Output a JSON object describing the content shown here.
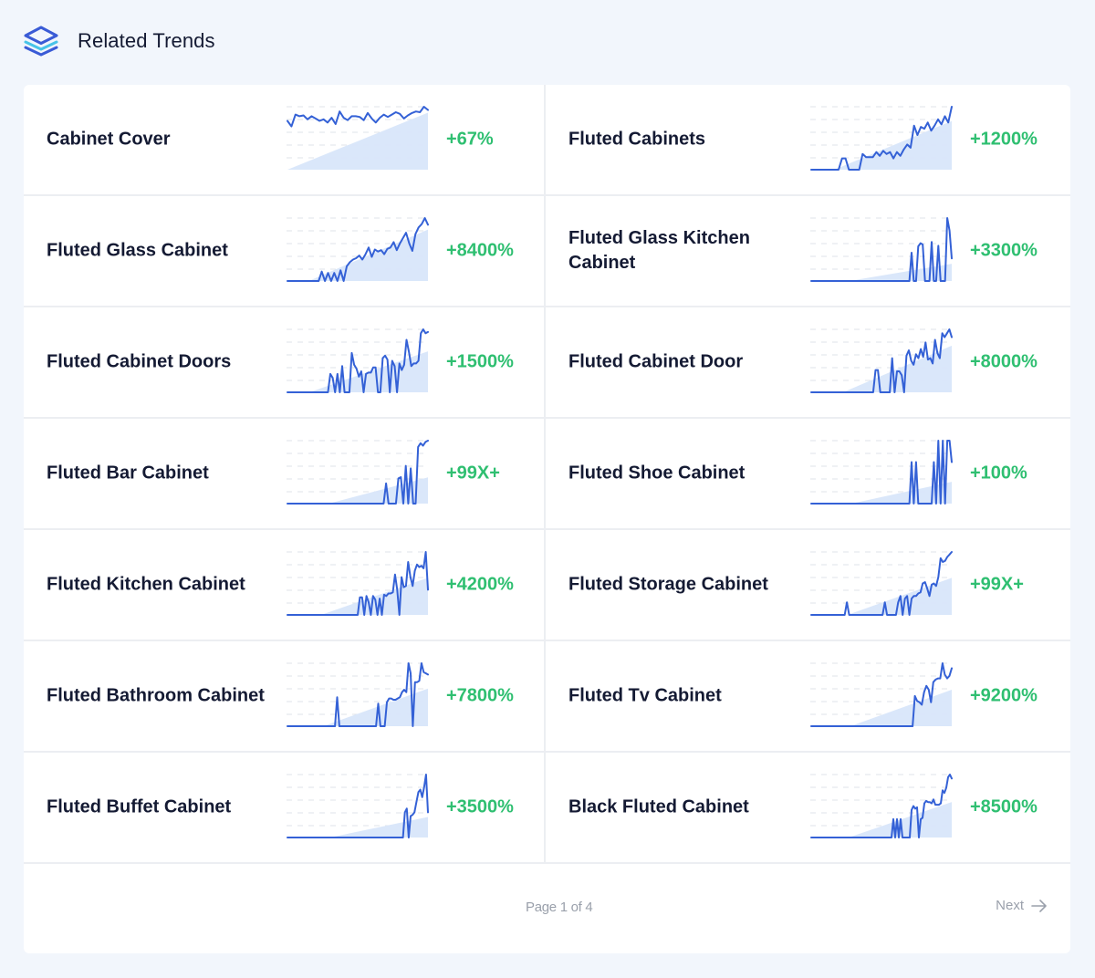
{
  "header": {
    "title": "Related Trends",
    "icon": "layers-icon"
  },
  "colors": {
    "line": "#3461d6",
    "fill": "#d8e6fa",
    "positive": "#2fbf71",
    "grid": "#dfe3ea"
  },
  "trends": [
    {
      "name": "Cabinet Cover",
      "change": "+67%",
      "series": [
        62,
        55,
        70,
        68,
        69,
        64,
        68,
        65,
        62,
        64,
        60,
        66,
        58,
        74,
        66,
        63,
        68,
        68,
        67,
        63,
        72,
        65,
        60,
        66,
        70,
        67,
        70,
        73,
        71,
        65,
        69,
        72,
        74,
        73,
        80,
        76
      ]
    },
    {
      "name": "Fluted Cabinets",
      "change": "+1200%",
      "series": [
        0,
        0,
        0,
        0,
        0,
        0,
        0,
        0,
        0,
        18,
        18,
        0,
        0,
        0,
        0,
        25,
        20,
        20,
        20,
        28,
        22,
        30,
        25,
        28,
        18,
        28,
        22,
        32,
        40,
        35,
        70,
        55,
        68,
        65,
        75,
        62,
        70,
        80,
        72,
        85,
        75,
        100
      ]
    },
    {
      "name": "Fluted Glass Cabinet",
      "change": "+8400%",
      "series": [
        0,
        0,
        0,
        0,
        0,
        0,
        0,
        0,
        0,
        0,
        0,
        14,
        0,
        12,
        0,
        12,
        0,
        16,
        0,
        22,
        28,
        32,
        34,
        38,
        32,
        40,
        50,
        36,
        47,
        44,
        46,
        40,
        48,
        50,
        58,
        46,
        56,
        64,
        72,
        56,
        45,
        70,
        80,
        85,
        94,
        84
      ]
    },
    {
      "name": "Fluted Glass Kitchen Cabinet",
      "change": "+3300%",
      "series": [
        0,
        0,
        0,
        0,
        0,
        0,
        0,
        0,
        0,
        0,
        0,
        0,
        0,
        0,
        0,
        0,
        0,
        0,
        0,
        0,
        0,
        0,
        0,
        0,
        0,
        0,
        0,
        0,
        0,
        0,
        0,
        0,
        0,
        0,
        0,
        0,
        0,
        0,
        0,
        0,
        0,
        0,
        0,
        0,
        0,
        45,
        0,
        0,
        55,
        60,
        58,
        0,
        0,
        0,
        62,
        0,
        0,
        56,
        0,
        0,
        0,
        100,
        80,
        36
      ]
    },
    {
      "name": "Fluted Cabinet Doors",
      "change": "+1500%",
      "series": [
        0,
        0,
        0,
        0,
        0,
        0,
        0,
        0,
        0,
        0,
        0,
        0,
        0,
        0,
        0,
        0,
        0,
        0,
        28,
        22,
        0,
        28,
        0,
        40,
        0,
        0,
        0,
        60,
        42,
        36,
        24,
        32,
        0,
        28,
        30,
        30,
        38,
        38,
        0,
        0,
        52,
        56,
        50,
        0,
        48,
        40,
        0,
        44,
        34,
        42,
        80,
        62,
        40,
        44,
        44,
        48,
        90,
        96,
        90,
        92
      ]
    },
    {
      "name": "Fluted Cabinet Door",
      "change": "+8000%",
      "series": [
        0,
        0,
        0,
        0,
        0,
        0,
        0,
        0,
        0,
        0,
        0,
        0,
        0,
        0,
        0,
        0,
        0,
        0,
        0,
        0,
        0,
        0,
        0,
        0,
        0,
        0,
        0,
        34,
        34,
        0,
        0,
        0,
        0,
        0,
        52,
        0,
        32,
        32,
        26,
        0,
        56,
        64,
        48,
        42,
        58,
        52,
        66,
        54,
        76,
        50,
        52,
        44,
        80,
        60,
        52,
        90,
        84,
        90,
        96,
        84
      ]
    },
    {
      "name": "Fluted Bar Cabinet",
      "change": "+99X+",
      "series": [
        0,
        0,
        0,
        0,
        0,
        0,
        0,
        0,
        0,
        0,
        0,
        0,
        0,
        0,
        0,
        0,
        0,
        0,
        0,
        0,
        0,
        0,
        0,
        0,
        0,
        0,
        0,
        0,
        0,
        0,
        0,
        0,
        0,
        0,
        0,
        0,
        0,
        0,
        0,
        0,
        32,
        0,
        0,
        0,
        0,
        40,
        42,
        0,
        60,
        0,
        56,
        0,
        0,
        90,
        96,
        92,
        98,
        100
      ]
    },
    {
      "name": "Fluted Shoe Cabinet",
      "change": "+100%",
      "series": [
        0,
        0,
        0,
        0,
        0,
        0,
        0,
        0,
        0,
        0,
        0,
        0,
        0,
        0,
        0,
        0,
        0,
        0,
        0,
        0,
        0,
        0,
        0,
        0,
        0,
        0,
        0,
        0,
        0,
        0,
        0,
        0,
        0,
        0,
        0,
        0,
        0,
        0,
        0,
        0,
        0,
        0,
        0,
        0,
        0,
        66,
        0,
        66,
        0,
        0,
        0,
        0,
        0,
        0,
        0,
        66,
        0,
        100,
        0,
        100,
        0,
        100,
        100,
        66
      ]
    },
    {
      "name": "Fluted Kitchen Cabinet",
      "change": "+4200%",
      "series": [
        0,
        0,
        0,
        0,
        0,
        0,
        0,
        0,
        0,
        0,
        0,
        0,
        0,
        0,
        0,
        0,
        0,
        0,
        0,
        0,
        0,
        0,
        0,
        0,
        0,
        0,
        0,
        0,
        0,
        0,
        0,
        0,
        0,
        28,
        28,
        0,
        30,
        20,
        0,
        30,
        24,
        0,
        26,
        0,
        32,
        30,
        34,
        34,
        36,
        64,
        40,
        0,
        60,
        44,
        46,
        84,
        60,
        46,
        70,
        80,
        76,
        78,
        74,
        100,
        40
      ]
    },
    {
      "name": "Fluted Storage Cabinet",
      "change": "+99X+",
      "series": [
        0,
        0,
        0,
        0,
        0,
        0,
        0,
        0,
        0,
        0,
        0,
        0,
        0,
        0,
        0,
        0,
        20,
        0,
        0,
        0,
        0,
        0,
        0,
        0,
        0,
        0,
        0,
        0,
        0,
        0,
        0,
        0,
        0,
        20,
        0,
        0,
        0,
        0,
        0,
        20,
        30,
        0,
        26,
        30,
        0,
        26,
        30,
        30,
        34,
        36,
        50,
        52,
        42,
        30,
        48,
        50,
        46,
        60,
        90,
        84,
        86,
        92,
        96,
        100
      ]
    },
    {
      "name": "Fluted Bathroom Cabinet",
      "change": "+7800%",
      "series": [
        0,
        0,
        0,
        0,
        0,
        0,
        0,
        0,
        0,
        0,
        0,
        0,
        0,
        0,
        0,
        0,
        0,
        0,
        0,
        0,
        0,
        0,
        0,
        46,
        0,
        0,
        0,
        0,
        0,
        0,
        0,
        0,
        0,
        0,
        0,
        0,
        0,
        0,
        0,
        0,
        0,
        0,
        36,
        0,
        0,
        0,
        38,
        44,
        44,
        42,
        42,
        44,
        46,
        54,
        58,
        54,
        100,
        84,
        0,
        70,
        70,
        72,
        100,
        86,
        84,
        82
      ]
    },
    {
      "name": "Fluted Tv Cabinet",
      "change": "+9200%",
      "series": [
        0,
        0,
        0,
        0,
        0,
        0,
        0,
        0,
        0,
        0,
        0,
        0,
        0,
        0,
        0,
        0,
        0,
        0,
        0,
        0,
        0,
        0,
        0,
        0,
        0,
        0,
        0,
        0,
        0,
        0,
        0,
        0,
        0,
        0,
        0,
        0,
        0,
        0,
        0,
        0,
        0,
        0,
        0,
        0,
        0,
        48,
        40,
        38,
        34,
        54,
        64,
        58,
        38,
        70,
        74,
        76,
        76,
        100,
        82,
        76,
        80,
        92
      ]
    },
    {
      "name": "Fluted Buffet Cabinet",
      "change": "+3500%",
      "series": [
        0,
        0,
        0,
        0,
        0,
        0,
        0,
        0,
        0,
        0,
        0,
        0,
        0,
        0,
        0,
        0,
        0,
        0,
        0,
        0,
        0,
        0,
        0,
        0,
        0,
        0,
        0,
        0,
        0,
        0,
        0,
        0,
        0,
        0,
        0,
        0,
        0,
        0,
        0,
        0,
        0,
        0,
        0,
        0,
        0,
        0,
        0,
        0,
        0,
        0,
        0,
        0,
        0,
        0,
        0,
        0,
        0,
        0,
        0,
        0,
        0,
        40,
        46,
        0,
        34,
        36,
        40,
        56,
        72,
        76,
        64,
        80,
        100,
        40
      ]
    },
    {
      "name": "Black Fluted Cabinet",
      "change": "+8500%",
      "series": [
        0,
        0,
        0,
        0,
        0,
        0,
        0,
        0,
        0,
        0,
        0,
        0,
        0,
        0,
        0,
        0,
        0,
        0,
        0,
        0,
        0,
        0,
        0,
        0,
        0,
        0,
        0,
        0,
        0,
        0,
        0,
        0,
        0,
        0,
        0,
        0,
        0,
        0,
        0,
        0,
        0,
        0,
        0,
        0,
        0,
        28,
        0,
        28,
        0,
        28,
        0,
        0,
        0,
        0,
        0,
        42,
        48,
        44,
        46,
        0,
        28,
        30,
        52,
        56,
        54,
        54,
        52,
        58,
        50,
        50,
        50,
        52,
        72,
        68,
        76,
        92,
        96,
        90
      ]
    }
  ],
  "pagination": {
    "label": "Page 1 of 4",
    "next_label": "Next"
  }
}
